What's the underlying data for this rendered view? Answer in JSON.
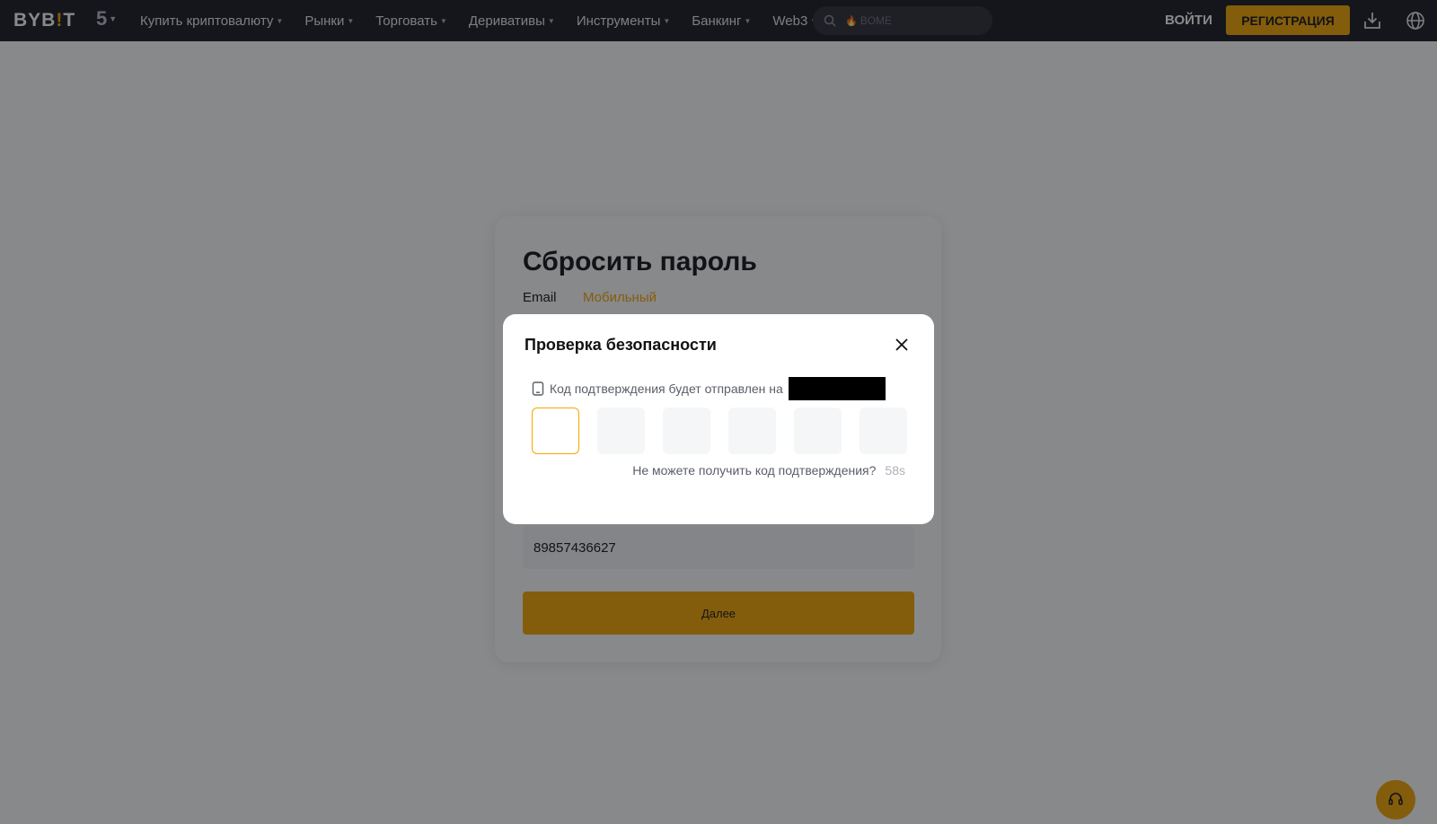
{
  "header": {
    "logo_left": "BYB",
    "logo_mid": "!",
    "logo_right": "T",
    "anniversary": "5",
    "nav": [
      {
        "label": "Купить криптовалюту"
      },
      {
        "label": "Рынки"
      },
      {
        "label": "Торговать"
      },
      {
        "label": "Деривативы"
      },
      {
        "label": "Инструменты"
      },
      {
        "label": "Банкинг"
      },
      {
        "label": "Web3"
      }
    ],
    "search_placeholder": "BOME",
    "login_label": "ВОЙТИ",
    "register_label": "РЕГИСТРАЦИЯ"
  },
  "reset_form": {
    "title": "Сбросить пароль",
    "tabs": [
      {
        "label": "Email",
        "active": false
      },
      {
        "label": "Мобильный",
        "active": true
      }
    ],
    "phone_value": "89857436627",
    "next_label": "Далее"
  },
  "security_modal": {
    "title": "Проверка безопасности",
    "info_text": "Код подтверждения будет отправлен на",
    "otp_count": 6,
    "resend_question": "Не можете получить код подтверждения?",
    "timer": "58s"
  },
  "colors": {
    "accent": "#f7a600",
    "nav_bg": "#17181e",
    "overlay": "rgba(18,19,24,0.50)"
  }
}
